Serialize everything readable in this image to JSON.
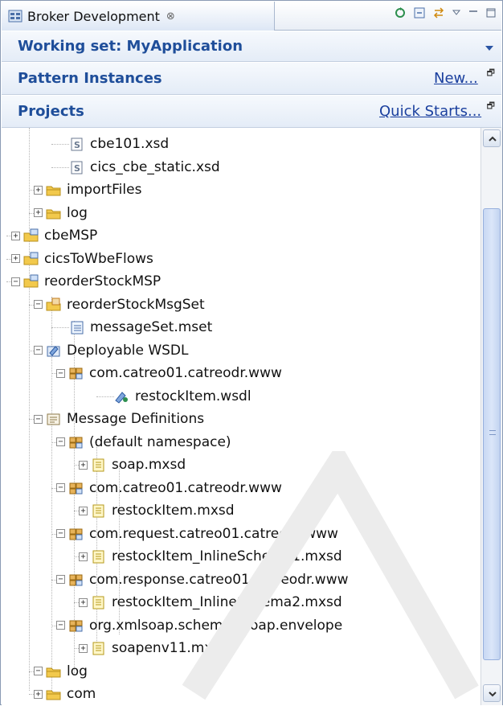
{
  "view": {
    "title": "Broker Development",
    "close_glyph": "⊗",
    "toolbar_icons": [
      "sync-icon",
      "collapse-all-icon",
      "link-editor-icon",
      "view-menu-icon",
      "minimize-icon",
      "maximize-icon"
    ]
  },
  "working_set": {
    "label": "Working set: MyApplication"
  },
  "pattern_instances": {
    "title": "Pattern Instances",
    "link": "New..."
  },
  "projects": {
    "title": "Projects",
    "link": "Quick Starts...",
    "tree": [
      {
        "label": "cbe101.xsd",
        "icon": "xsd-file-icon",
        "toggle": ""
      },
      {
        "label": "cics_cbe_static.xsd",
        "icon": "xsd-file-icon",
        "toggle": ""
      },
      {
        "label": "importFiles",
        "icon": "folder-icon",
        "toggle": "+"
      },
      {
        "label": "log",
        "icon": "folder-icon",
        "toggle": "+"
      },
      {
        "label": "cbeMSP",
        "icon": "project-icon",
        "toggle": "+"
      },
      {
        "label": "cicsToWbeFlows",
        "icon": "project-icon",
        "toggle": "+"
      },
      {
        "label": "reorderStockMSP",
        "icon": "project-icon",
        "toggle": "−"
      },
      {
        "label": "reorderStockMsgSet",
        "icon": "message-set-folder-icon",
        "toggle": "−"
      },
      {
        "label": "messageSet.mset",
        "icon": "mset-file-icon",
        "toggle": ""
      },
      {
        "label": "Deployable WSDL",
        "icon": "wsdl-folder-icon",
        "toggle": "−"
      },
      {
        "label": "com.catreo01.catreodr.www",
        "icon": "namespace-icon",
        "toggle": "−"
      },
      {
        "label": "restockItem.wsdl",
        "icon": "wsdl-file-icon",
        "toggle": ""
      },
      {
        "label": "Message Definitions",
        "icon": "message-definitions-icon",
        "toggle": "−"
      },
      {
        "label": "(default namespace)",
        "icon": "namespace-icon",
        "toggle": "−"
      },
      {
        "label": "soap.mxsd",
        "icon": "mxsd-file-icon",
        "toggle": "+"
      },
      {
        "label": "com.catreo01.catreodr.www",
        "icon": "namespace-icon",
        "toggle": "−"
      },
      {
        "label": "restockItem.mxsd",
        "icon": "mxsd-file-icon",
        "toggle": "+"
      },
      {
        "label": "com.request.catreo01.catreodr.www",
        "icon": "namespace-icon",
        "toggle": "−"
      },
      {
        "label": "restockItem_InlineSchema1.mxsd",
        "icon": "mxsd-file-icon",
        "toggle": "+"
      },
      {
        "label": "com.response.catreo01.catreodr.www",
        "icon": "namespace-icon",
        "toggle": "−"
      },
      {
        "label": "restockItem_InlineSchema2.mxsd",
        "icon": "mxsd-file-icon",
        "toggle": "+"
      },
      {
        "label": "org.xmlsoap.schemas.soap.envelope",
        "icon": "namespace-icon",
        "toggle": "−"
      },
      {
        "label": "soapenv11.mxsd",
        "icon": "mxsd-file-icon",
        "toggle": "+"
      },
      {
        "label": "log",
        "icon": "folder-icon",
        "toggle": "−"
      },
      {
        "label": "com",
        "icon": "folder-icon",
        "toggle": "+"
      }
    ]
  },
  "colors": {
    "section_title": "#1f4e9a",
    "link": "#1a3f9e",
    "scroll_thumb": "#c8d8f3",
    "folder": "#f2c94c"
  }
}
